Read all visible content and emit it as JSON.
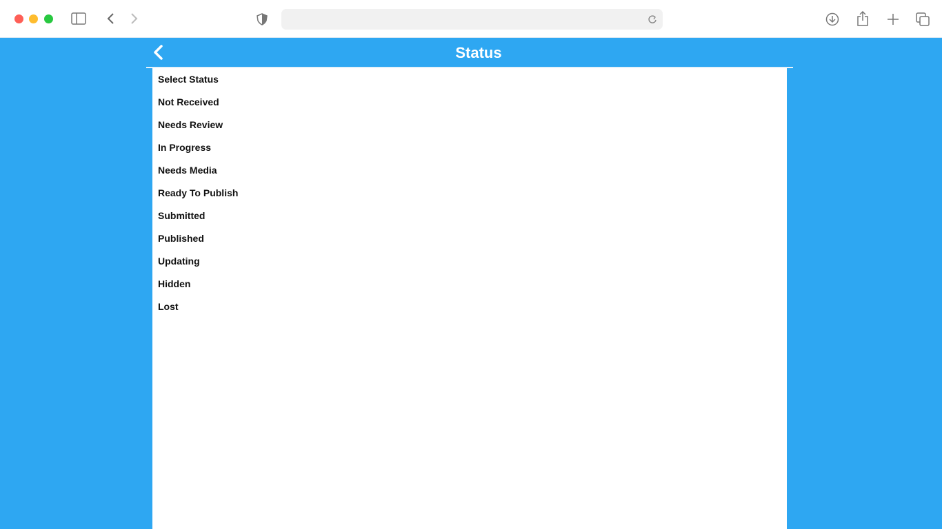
{
  "browser": {
    "icons": [
      "sidebar-icon",
      "back-icon",
      "forward-icon",
      "shield-icon",
      "reload-icon",
      "download-icon",
      "share-icon",
      "new-tab-icon",
      "tabs-overview-icon"
    ],
    "url": ""
  },
  "header": {
    "title": "Status",
    "back_icon": "chevron-left-icon"
  },
  "colors": {
    "brand": "#2ea7f2"
  },
  "statuses": [
    "Select Status",
    "Not Received",
    "Needs Review",
    "In Progress",
    "Needs Media",
    "Ready To Publish",
    "Submitted",
    "Published",
    "Updating",
    "Hidden",
    "Lost"
  ]
}
